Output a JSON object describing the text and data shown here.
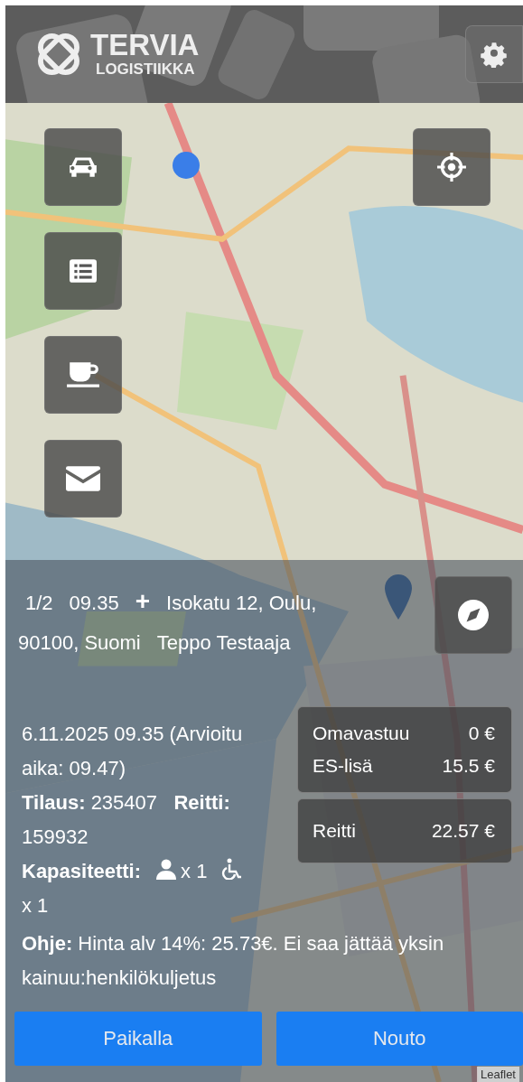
{
  "header": {
    "logo_title": "TERVIA",
    "logo_subtitle": "LOGISTIIKKA"
  },
  "map_buttons": [
    {
      "kind": "car"
    },
    {
      "kind": "list"
    },
    {
      "kind": "cup"
    },
    {
      "kind": "mail"
    }
  ],
  "task": {
    "counter": "1/2",
    "time": "09.35",
    "symbol": "+",
    "address": "Isokatu 12, Oulu, 90100, Suomi",
    "customer": "Teppo Testaaja"
  },
  "details": {
    "datetime": "6.11.2025 09.35 (Arvioitu aika: 09.47)",
    "order_route": "**Tilaus:** 235407   **Reitti:** 159932",
    "capacity_label": "Kapasiteetti:",
    "capacity": [
      {
        "kind": "person",
        "text": "x 1"
      },
      {
        "kind": "wheelchair",
        "text": "x 1"
      }
    ],
    "note": "**Ohje:** Hinta alv 14%: 25.73€. Ei saa jättää yksin kainuu:henkilökuljetus"
  },
  "price_groups": [
    {
      "rows": [
        {
          "label": "Omavastuu",
          "value": "0 €"
        },
        {
          "label": "ES-lisä",
          "value": "15.5 €"
        }
      ]
    },
    {
      "rows": [
        {
          "label": "Reitti",
          "value": "22.57 €"
        }
      ]
    }
  ],
  "buttons": [
    "Paikalla",
    "Nouto"
  ],
  "attribution": "Leaflet"
}
